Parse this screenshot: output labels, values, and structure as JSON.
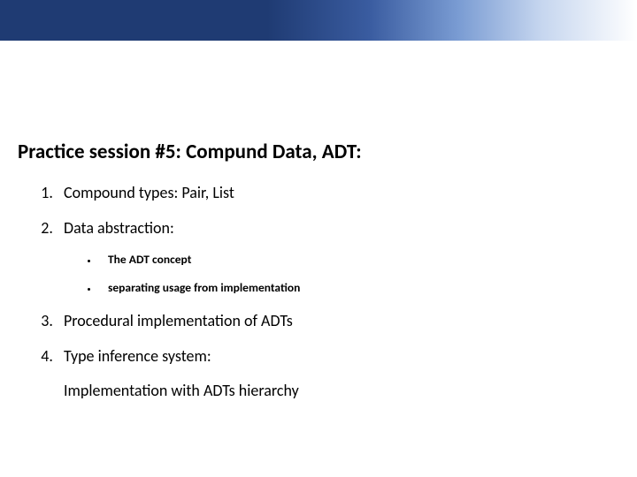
{
  "title": "Practice session #5: Compund Data, ADT:",
  "items": [
    {
      "text": "Compound types: Pair, List"
    },
    {
      "text": "Data abstraction:",
      "sub": [
        "The ADT concept",
        "separating usage from implementation"
      ]
    },
    {
      "text": "Procedural implementation of ADTs"
    },
    {
      "text": "Type inference system:",
      "tail": "Implementation with ADTs hierarchy"
    }
  ]
}
